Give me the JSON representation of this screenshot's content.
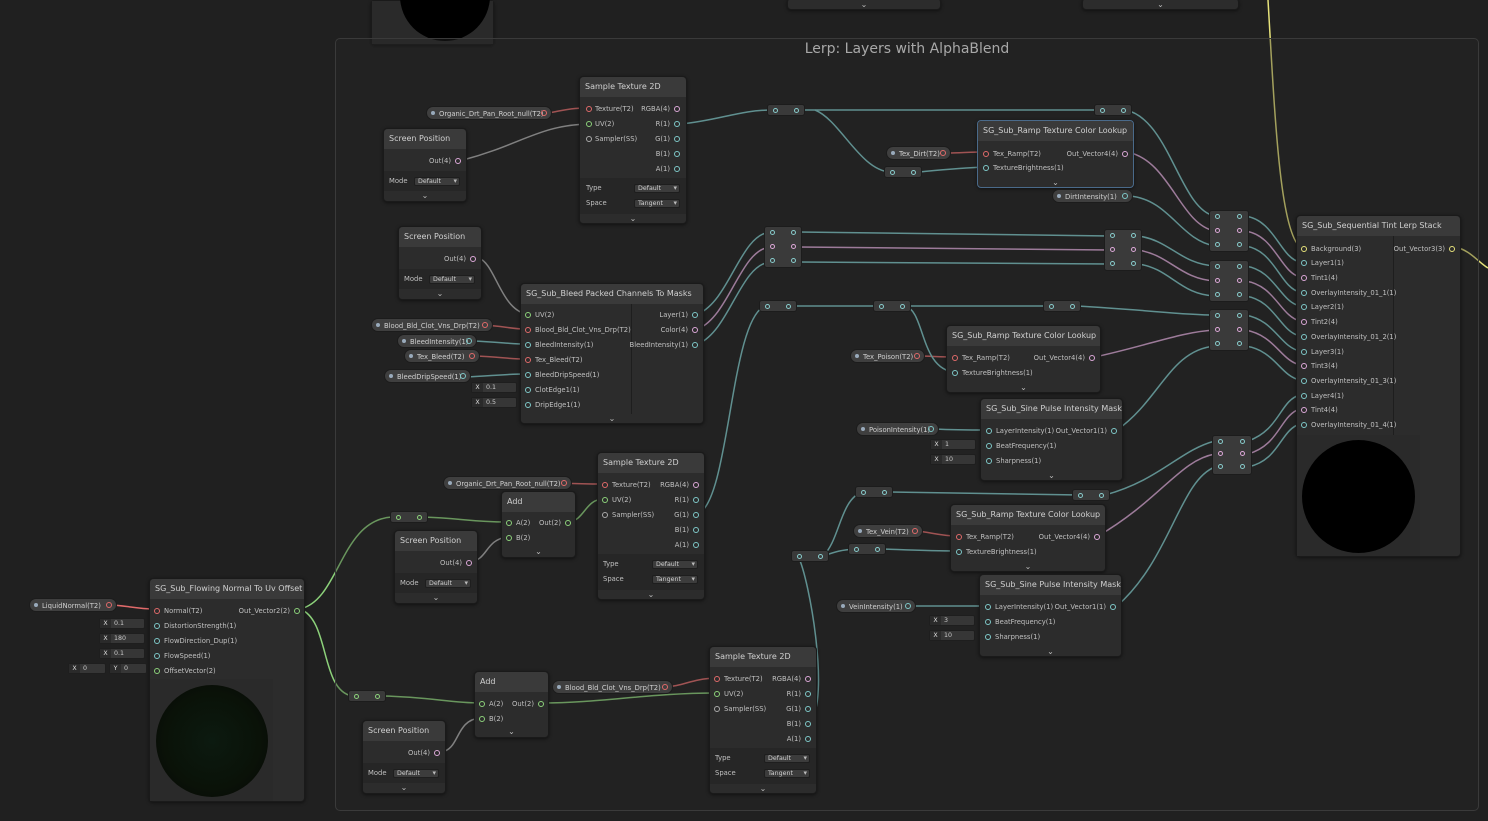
{
  "group": {
    "title": "Lerp: Layers with AlphaBlend"
  },
  "colors": {
    "texture": "#e06a6a",
    "vector": "#7ec8c8",
    "vector2": "#8cd17a",
    "vector4": "#dca8d8",
    "vector3": "#e6e27a",
    "wire_grey": "#b0b0b0"
  },
  "icons": {
    "collapse": "chevron-down-icon",
    "port": "port-dot-icon"
  },
  "nodes": {
    "sample1": {
      "title": "Sample Texture 2D",
      "in": [
        "Texture(T2)",
        "UV(2)",
        "Sampler(SS)"
      ],
      "out": [
        "RGBA(4)",
        "R(1)",
        "G(1)",
        "B(1)",
        "A(1)"
      ],
      "type_label": "Type",
      "type_value": "Default",
      "space_label": "Space",
      "space_value": "Tangent"
    },
    "sample2": {
      "title": "Sample Texture 2D",
      "in": [
        "Texture(T2)",
        "UV(2)",
        "Sampler(SS)"
      ],
      "out": [
        "RGBA(4)",
        "R(1)",
        "G(1)",
        "B(1)",
        "A(1)"
      ],
      "type_label": "Type",
      "type_value": "Default",
      "space_label": "Space",
      "space_value": "Tangent"
    },
    "sample3": {
      "title": "Sample Texture 2D",
      "in": [
        "Texture(T2)",
        "UV(2)",
        "Sampler(SS)"
      ],
      "out": [
        "RGBA(4)",
        "R(1)",
        "G(1)",
        "B(1)",
        "A(1)"
      ],
      "type_label": "Type",
      "type_value": "Default",
      "space_label": "Space",
      "space_value": "Tangent"
    },
    "screen1": {
      "title": "Screen Position",
      "out": "Out(4)",
      "mode_label": "Mode",
      "mode_value": "Default"
    },
    "screen2": {
      "title": "Screen Position",
      "out": "Out(4)",
      "mode_label": "Mode",
      "mode_value": "Default"
    },
    "screen3": {
      "title": "Screen Position",
      "out": "Out(4)",
      "mode_label": "Mode",
      "mode_value": "Default"
    },
    "screen4": {
      "title": "Screen Position",
      "out": "Out(4)",
      "mode_label": "Mode",
      "mode_value": "Default"
    },
    "ramp1": {
      "title": "SG_Sub_Ramp Texture Color Lookup",
      "in": [
        "Tex_Ramp(T2)",
        "TextureBrightness(1)"
      ],
      "out": "Out_Vector4(4)"
    },
    "ramp2": {
      "title": "SG_Sub_Ramp Texture Color Lookup",
      "in": [
        "Tex_Ramp(T2)",
        "TextureBrightness(1)"
      ],
      "out": "Out_Vector4(4)"
    },
    "ramp3": {
      "title": "SG_Sub_Ramp Texture Color Lookup",
      "in": [
        "Tex_Ramp(T2)",
        "TextureBrightness(1)"
      ],
      "out": "Out_Vector4(4)"
    },
    "bleed": {
      "title": "SG_Sub_Bleed Packed Channels To Masks",
      "in": [
        "UV(2)",
        "Blood_Bld_Clot_Vns_Drp(T2)",
        "BleedIntensity(1)",
        "Tex_Bleed(T2)",
        "BleedDripSpeed(1)",
        "ClotEdge1(1)",
        "DripEdge1(1)"
      ],
      "out": [
        "Layer(1)",
        "Color(4)",
        "BleedIntensity(1)"
      ],
      "clot_x": "0.1",
      "drip_x": "0.5"
    },
    "sine1": {
      "title": "SG_Sub_Sine Pulse Intensity Mask",
      "in": [
        "LayerIntensity(1)",
        "BeatFrequency(1)",
        "Sharpness(1)"
      ],
      "out": "Out_Vector1(1)",
      "beat_x": "1",
      "sharp_x": "10"
    },
    "sine2": {
      "title": "SG_Sub_Sine Pulse Intensity Mask",
      "in": [
        "LayerIntensity(1)",
        "BeatFrequency(1)",
        "Sharpness(1)"
      ],
      "out": "Out_Vector1(1)",
      "beat_x": "3",
      "sharp_x": "10"
    },
    "add1": {
      "title": "Add",
      "in": [
        "A(2)",
        "B(2)"
      ],
      "out": "Out(2)"
    },
    "add2": {
      "title": "Add",
      "in": [
        "A(2)",
        "B(2)"
      ],
      "out": "Out(2)"
    },
    "flow": {
      "title": "SG_Sub_Flowing Normal To Uv Offset",
      "in": [
        "Normal(T2)",
        "DistortionStrength(1)",
        "FlowDirection_Dup(1)",
        "FlowSpeed(1)",
        "OffsetVector(2)"
      ],
      "out": "Out_Vector2(2)",
      "dist_x": "0.1",
      "dir_x": "180",
      "speed_x": "0.1",
      "off_x": "0",
      "off_y": "0"
    },
    "tint": {
      "title": "SG_Sub_Sequential Tint Lerp Stack",
      "in": [
        "Background(3)",
        "Layer1(1)",
        "Tint1(4)",
        "OverlayIntensity_01_1(1)",
        "Layer2(1)",
        "Tint2(4)",
        "OverlayIntensity_01_2(1)",
        "Layer3(1)",
        "Tint3(4)",
        "OverlayIntensity_01_3(1)",
        "Layer4(1)",
        "Tint4(4)",
        "OverlayIntensity_01_4(1)"
      ],
      "out": "Out_Vector3(3)"
    }
  },
  "props": {
    "organic1": "Organic_Drt_Pan_Root_null(T2)",
    "organic2": "Organic_Drt_Pan_Root_null(T2)",
    "blood1": "Blood_Bld_Clot_Vns_Drp(T2)",
    "blood2": "Blood_Bld_Clot_Vns_Drp(T2)",
    "bleedint": "BleedIntensity(1)",
    "texbleed": "Tex_Bleed(T2)",
    "bleeddrip": "BleedDripSpeed(1)",
    "texdirt": "Tex_Dirt(T2)",
    "dirtint": "DirtIntensity(1)",
    "texpoison": "Tex_Poison(T2)",
    "poisonint": "PoisonIntensity(1)",
    "texvein": "Tex_Vein(T2)",
    "veinint": "VeinIntensity(1)",
    "liquidnormal": "LiquidNormal(T2)"
  },
  "axis_x": "X",
  "axis_y": "Y"
}
